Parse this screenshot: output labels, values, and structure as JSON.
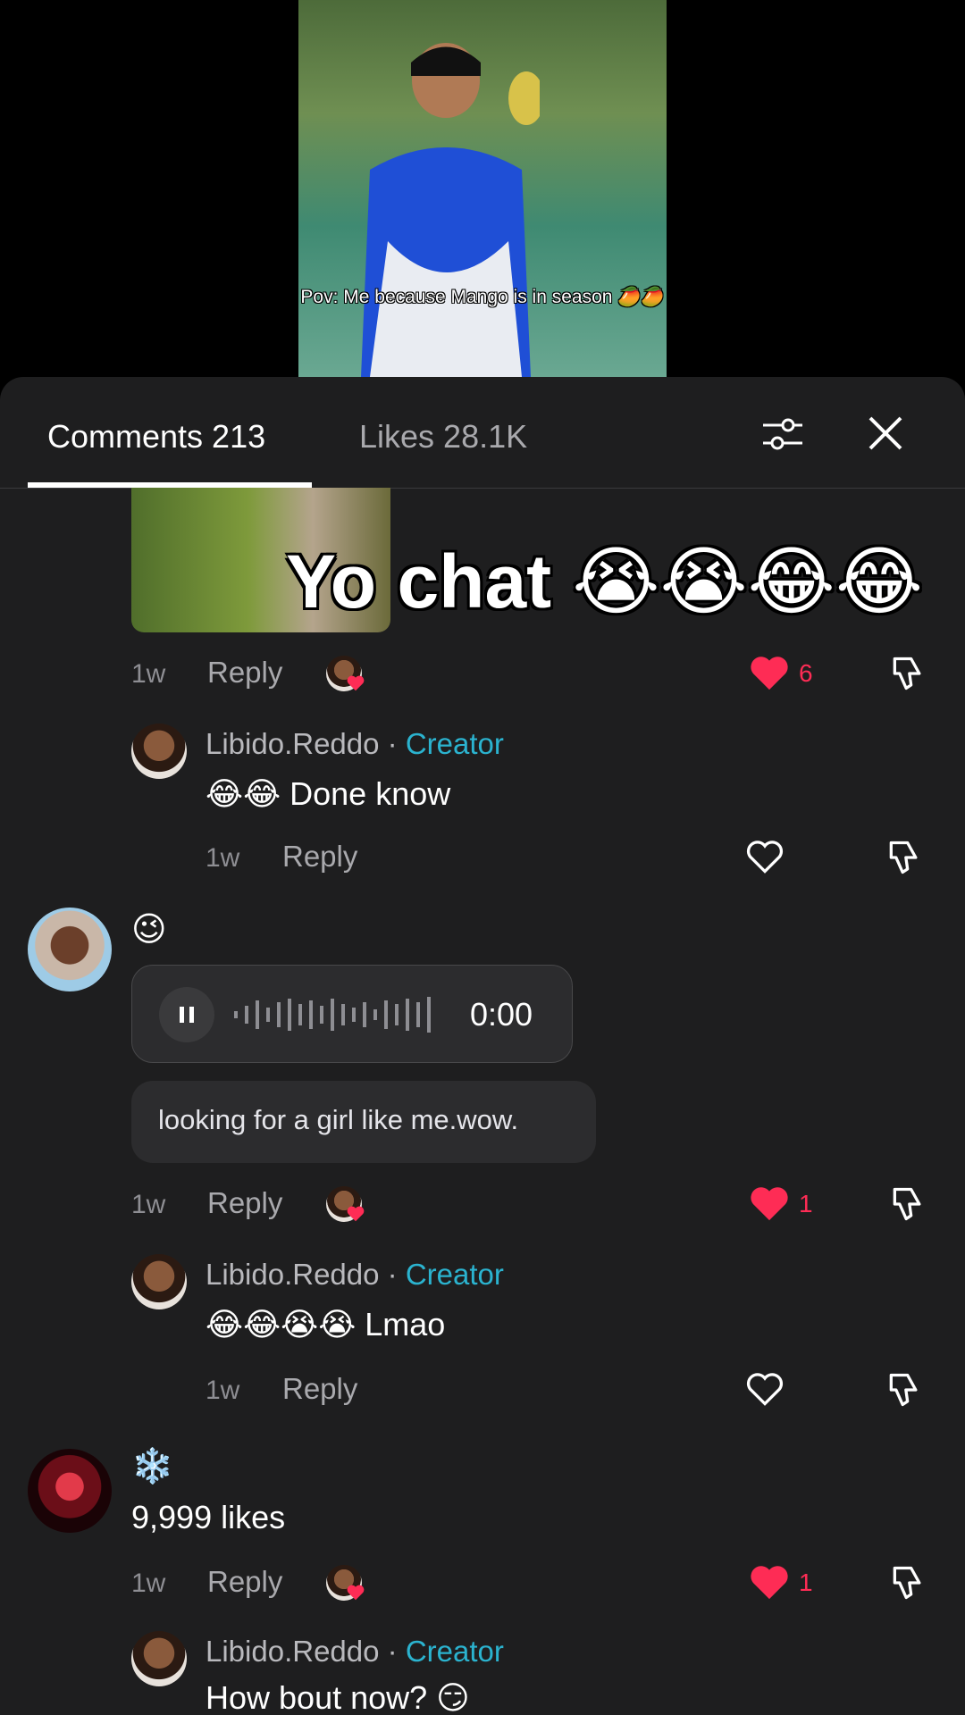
{
  "video": {
    "caption": "Pov: Me because Mango is in season 🥭🥭"
  },
  "header": {
    "tabs": [
      "Comments 213",
      "Likes 28.1K"
    ]
  },
  "icons": {
    "filter": "filter-sliders-icon",
    "close": "close-icon",
    "heart": "heart-icon",
    "dislike": "thumbs-down-icon"
  },
  "colors": {
    "accent_red": "#fe2c55",
    "creator_blue": "#2bb3cf",
    "panel_bg": "#1e1e1f"
  },
  "reply_label": "Reply",
  "comments": [
    {
      "sticker_text": "Yo chat 😭😭😂😂",
      "time": "1w",
      "likes": "6",
      "liked": true
    },
    {
      "username": "Libido.Reddo",
      "badge": "Creator",
      "text": "😂😂 Done know",
      "time": "1w"
    },
    {
      "emoji": "😉",
      "audio_time": "0:00",
      "transcript": "looking for a girl like me.wow.",
      "time": "1w",
      "likes": "1",
      "liked": true
    },
    {
      "username": "Libido.Reddo",
      "badge": "Creator",
      "text": "😂😂😭😭 Lmao",
      "time": "1w"
    },
    {
      "emoji": "❄️",
      "text": "9,999 likes",
      "time": "1w",
      "likes": "1",
      "liked": true
    },
    {
      "username": "Libido.Reddo",
      "badge": "Creator",
      "text": "How bout now? 😏"
    }
  ]
}
